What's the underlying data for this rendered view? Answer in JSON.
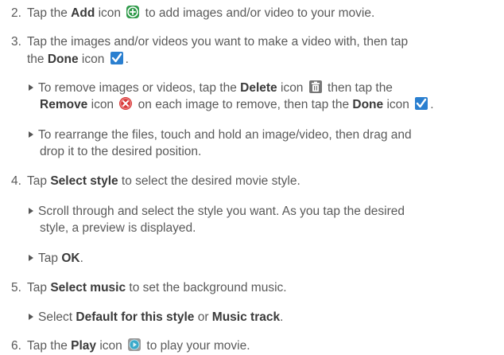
{
  "steps": {
    "s2": {
      "num": "2.",
      "pre": "Tap the ",
      "bold1": "Add",
      "mid": " icon",
      "post": " to add images and/or video to your movie."
    },
    "s3": {
      "num": "3.",
      "line1": "Tap the images and/or videos you want to make a video with, then tap",
      "line2_pre": "the ",
      "bold1": "Done",
      "line2_post": " icon"
    },
    "b_remove": {
      "pre": "To remove images or videos, tap the ",
      "bold1": "Delete",
      "mid1": " icon",
      "mid2": " then tap the",
      "bold2": "Remove",
      "mid3": " icon",
      "mid4": " on each image to remove, then tap the ",
      "bold3": "Done",
      "mid5": " icon"
    },
    "b_rearrange": {
      "line1": "To rearrange the files, touch and hold an image/video, then drag and",
      "line2": "drop it to the desired position."
    },
    "s4": {
      "num": "4.",
      "pre": "Tap ",
      "bold1": "Select style",
      "post": " to select the desired movie style."
    },
    "b_scroll": {
      "line1": "Scroll through and select the style you want. As you tap the desired",
      "line2": "style, a preview is displayed."
    },
    "b_ok": {
      "pre": "Tap ",
      "bold1": "OK",
      "post": "."
    },
    "s5": {
      "num": "5.",
      "pre": "Tap ",
      "bold1": "Select music",
      "post": " to set the background music."
    },
    "b_select": {
      "pre": "Select ",
      "bold1": "Default for this style",
      "mid": " or ",
      "bold2": "Music track",
      "post": "."
    },
    "s6": {
      "num": "6.",
      "pre": "Tap the ",
      "bold1": "Play",
      "mid": " icon",
      "post": " to play your movie."
    }
  },
  "icons": {
    "add": "add-icon",
    "done": "checkmark-icon",
    "delete": "trash-icon",
    "remove": "remove-icon",
    "play": "play-icon"
  },
  "colors": {
    "text": "#5a5a5a",
    "bold": "#3a3a3a",
    "add_icon": "#2f9a4a",
    "done_icon": "#2a7fd0",
    "remove_icon": "#d83a3a",
    "trash_icon": "#777777",
    "play_icon": "#3aa9c9"
  }
}
